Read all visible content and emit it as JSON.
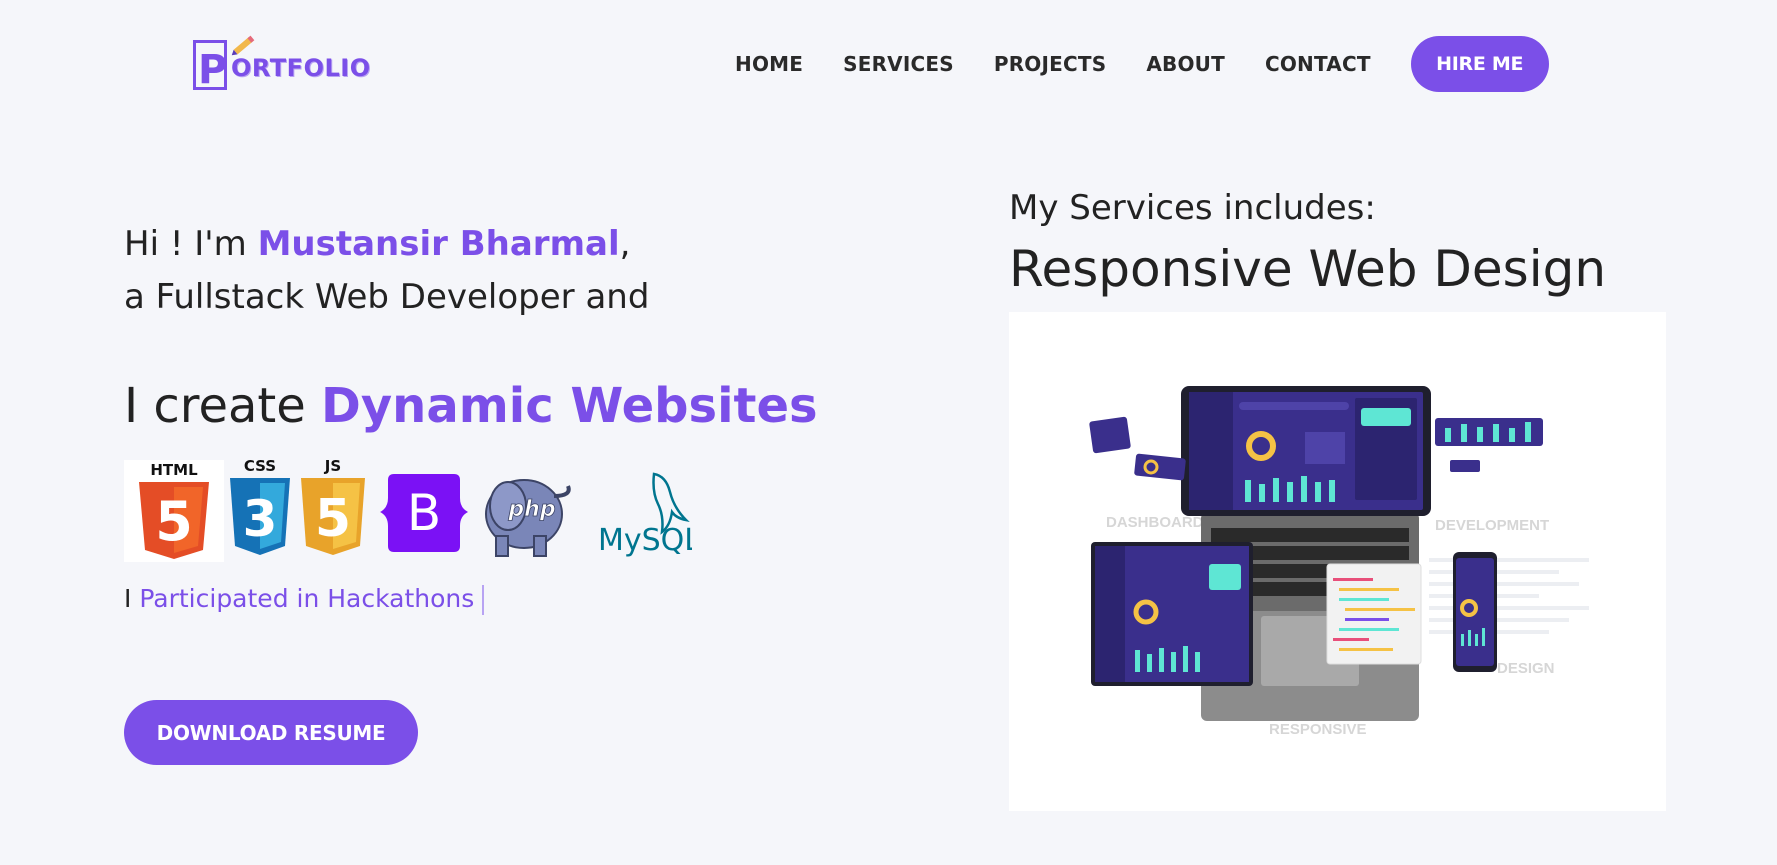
{
  "header": {
    "logo": {
      "initial": "P",
      "rest": "ORTFOLIO"
    },
    "nav": [
      {
        "label": "HOME"
      },
      {
        "label": "SERVICES"
      },
      {
        "label": "PROJECTS"
      },
      {
        "label": "ABOUT"
      },
      {
        "label": "CONTACT"
      }
    ],
    "hire_label": "HIRE ME"
  },
  "hero": {
    "greeting_prefix": "Hi ! I'm ",
    "name": "Mustansir Bharmal",
    "greeting_suffix": ",",
    "role_line": "a Fullstack Web Developer and",
    "create_prefix": "I create ",
    "create_highlight": "Dynamic Websites",
    "tech_icons": [
      {
        "icon": "html5-icon",
        "label": "HTML",
        "glyph": "5",
        "color": "#e44d26"
      },
      {
        "icon": "css3-icon",
        "label": "CSS",
        "glyph": "3",
        "color": "#1572b6"
      },
      {
        "icon": "javascript-icon",
        "label": "JS",
        "glyph": "5",
        "color": "#f0a92b"
      },
      {
        "icon": "bootstrap-icon",
        "glyph": "B",
        "color": "#7b11f5"
      },
      {
        "icon": "php-icon",
        "glyph": "php",
        "color": "#7a86b8"
      },
      {
        "icon": "mysql-icon",
        "glyph": "MySQL",
        "color": "#00758f"
      }
    ],
    "typed_prefix": "I ",
    "typed_text": "Participated in Hackathons",
    "download_label": "DOWNLOAD RESUME"
  },
  "services": {
    "label": "My Services includes:",
    "current": "Responsive Web Design",
    "illustration_labels": {
      "dashboard": "DASHBOARD",
      "development": "DEVELOPMENT",
      "design": "DESIGN",
      "responsive": "RESPONSIVE"
    }
  },
  "colors": {
    "accent": "#7b4fe8",
    "background": "#f5f6fa",
    "text": "#222222"
  }
}
